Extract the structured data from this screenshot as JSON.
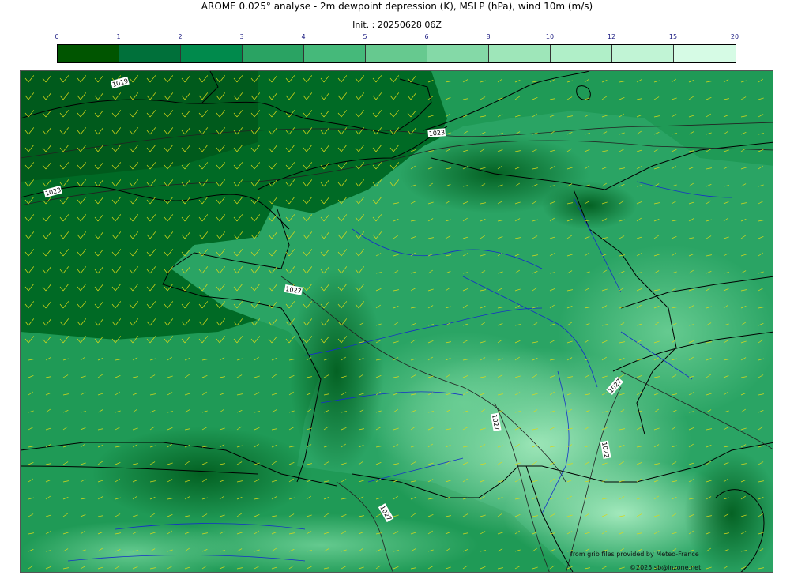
{
  "header": {
    "title": "AROME 0.025° analyse - 2m dewpoint depression (K), MSLP (hPa), wind 10m (m/s)",
    "init": "Init. : 20250628 06Z"
  },
  "colorbar": {
    "ticks": [
      "0",
      "1",
      "2",
      "3",
      "4",
      "5",
      "6",
      "8",
      "10",
      "12",
      "15",
      "20"
    ],
    "colors": [
      "#005500",
      "#00703a",
      "#008a4c",
      "#2aa363",
      "#45b97a",
      "#66c98f",
      "#84d9a7",
      "#9ee6b9",
      "#b0efc8",
      "#c1f4d5",
      "#d6fbe5"
    ]
  },
  "map": {
    "isobar_labels": [
      "1019",
      "1023",
      "1023",
      "1027",
      "1027",
      "1027",
      "1022",
      "1027"
    ],
    "colors": {
      "ocean": "#1f9a56",
      "ocean_dark": "#006e2d",
      "land": "#2aa464",
      "land_light": "#6ccf95",
      "land_pale": "#a8ecc0",
      "coast": "#000000",
      "river": "#1530c8",
      "wind_barb": "#d8d81a"
    }
  },
  "footer": {
    "source": "from grib files provided by Meteo-France",
    "copyright": "©2025 sb@inzone.net"
  }
}
